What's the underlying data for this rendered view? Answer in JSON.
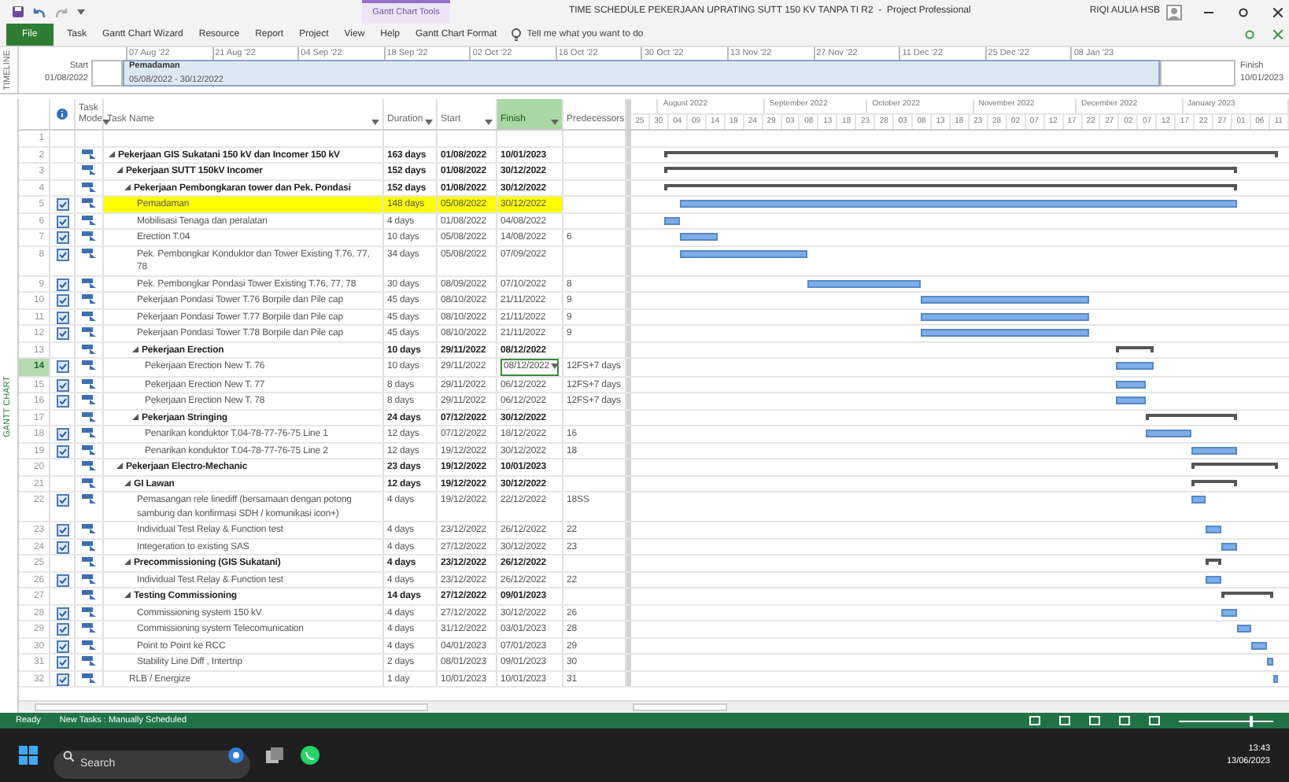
{
  "window": {
    "title": "TIME SCHEDULE PEKERJAAN UPRATING SUTT 150 KV TANPA TI R2  -  Project Professional",
    "context_group": "Gantt Chart Tools",
    "user": "RIQI AULIA HSB"
  },
  "ribbon_tabs": [
    {
      "label": "File",
      "kind": "file"
    },
    {
      "label": "Task",
      "kind": "normal"
    },
    {
      "label": "Gantt Chart Wizard",
      "kind": "normal"
    },
    {
      "label": "Resource",
      "kind": "normal"
    },
    {
      "label": "Report",
      "kind": "normal"
    },
    {
      "label": "Project",
      "kind": "normal"
    },
    {
      "label": "View",
      "kind": "normal"
    },
    {
      "label": "Help",
      "kind": "normal"
    },
    {
      "label": "Gantt Chart Format",
      "kind": "contextual"
    }
  ],
  "tell_me": {
    "placeholder": "Tell me what you want to do"
  },
  "timeline": {
    "label": "TIMELINE",
    "start_label": "Start",
    "start_date": "01/08/2022",
    "finish_label": "Finish",
    "finish_date": "10/01/2023",
    "dates": [
      "07 Aug '22",
      "21 Aug '22",
      "04 Sep '22",
      "18 Sep '22",
      "02 Oct '22",
      "16 Oct '22",
      "30 Oct '22",
      "13 Nov '22",
      "27 Nov '22",
      "11 Dec '22",
      "25 Dec '22",
      "08 Jan '23"
    ],
    "bar": {
      "name": "Pemadaman",
      "range": "05/08/2022 - 30/12/2022"
    }
  },
  "view_label": "GANTT CHART",
  "table": {
    "columns": [
      {
        "label": "Task Mode",
        "filter": true,
        "selected": false
      },
      {
        "label": "Task Name",
        "filter": true,
        "selected": false
      },
      {
        "label": "Duration",
        "filter": true,
        "selected": false
      },
      {
        "label": "Start",
        "filter": true,
        "selected": false
      },
      {
        "label": "Finish",
        "filter": true,
        "selected": true
      },
      {
        "label": "Predecessors",
        "filter": false,
        "selected": false
      }
    ],
    "rows": [
      {
        "row_number": "1",
        "kind": "blank",
        "selected": false,
        "highlighted": false
      },
      {
        "row_number": "2",
        "kind": "summary",
        "name": "Pekerjaan GIS Sukatani 150 kV dan Incomer 150 kV",
        "duration": "163 days",
        "start": "01/08/2022",
        "finish": "10/01/2023",
        "selected": false,
        "highlighted": false,
        "children": [
          {
            "row_number": "3",
            "kind": "summary",
            "name": "Pekerjaan SUTT 150kV Incomer",
            "duration": "152 days",
            "start": "01/08/2022",
            "finish": "30/12/2022",
            "selected": false,
            "highlighted": false,
            "children": [
              {
                "row_number": "4",
                "kind": "summary",
                "name": "Pekerjaan Pembongkaran tower dan Pek. Pondasi",
                "duration": "152 days",
                "start": "01/08/2022",
                "finish": "30/12/2022",
                "selected": false,
                "highlighted": false,
                "children": [
                  {
                    "row_number": "5",
                    "kind": "task",
                    "name": "Pemadaman",
                    "duration": "148 days",
                    "start": "05/08/2022",
                    "finish": "30/12/2022",
                    "selected": false,
                    "highlighted": true
                  },
                  {
                    "row_number": "6",
                    "kind": "task",
                    "name": "Mobilisasi Tenaga dan peralatan",
                    "duration": "4 days",
                    "start": "01/08/2022",
                    "finish": "04/08/2022",
                    "selected": false,
                    "highlighted": false
                  },
                  {
                    "row_number": "7",
                    "kind": "task",
                    "name": "Erection T.04",
                    "duration": "10 days",
                    "start": "05/08/2022",
                    "finish": "14/08/2022",
                    "predecessors": "6",
                    "selected": false,
                    "highlighted": false
                  },
                  {
                    "row_number": "8",
                    "kind": "task",
                    "name": "Pek. Pembongkar Konduktor dan Tower Existing T.76, 77, 78",
                    "duration": "34 days",
                    "start": "05/08/2022",
                    "finish": "07/09/2022",
                    "selected": false,
                    "highlighted": false
                  },
                  {
                    "row_number": "9",
                    "kind": "task",
                    "name": "Pek. Pembongkar Pondasi Tower Existing T.76, 77, 78",
                    "duration": "30 days",
                    "start": "08/09/2022",
                    "finish": "07/10/2022",
                    "predecessors": "8",
                    "selected": false,
                    "highlighted": false
                  },
                  {
                    "row_number": "10",
                    "kind": "task",
                    "name": "Pekerjaan Pondasi Tower T.76 Borpile dan Pile cap",
                    "duration": "45 days",
                    "start": "08/10/2022",
                    "finish": "21/11/2022",
                    "predecessors": "9",
                    "selected": false,
                    "highlighted": false
                  },
                  {
                    "row_number": "11",
                    "kind": "task",
                    "name": "Pekerjaan Pondasi Tower T.77 Borpile dan Pile cap",
                    "duration": "45 days",
                    "start": "08/10/2022",
                    "finish": "21/11/2022",
                    "predecessors": "9",
                    "selected": false,
                    "highlighted": false
                  },
                  {
                    "row_number": "12",
                    "kind": "task",
                    "name": "Pekerjaan Pondasi Tower T.78 Borpile dan Pile cap",
                    "duration": "45 days",
                    "start": "08/10/2022",
                    "finish": "21/11/2022",
                    "predecessors": "9",
                    "selected": false,
                    "highlighted": false
                  },
                  {
                    "row_number": "13",
                    "kind": "summary",
                    "name": "Pekerjaan Erection",
                    "duration": "10 days",
                    "start": "29/11/2022",
                    "finish": "08/12/2022",
                    "selected": false,
                    "highlighted": false,
                    "children": [
                      {
                        "row_number": "14",
                        "kind": "task",
                        "name": "Pekerjaan Erection New T. 76",
                        "duration": "10 days",
                        "start": "29/11/2022",
                        "finish": "08/12/2022",
                        "predecessors": "12FS+7 days",
                        "selected": true,
                        "highlighted": false
                      },
                      {
                        "row_number": "15",
                        "kind": "task",
                        "name": "Pekerjaan Erection New T. 77",
                        "duration": "8 days",
                        "start": "29/11/2022",
                        "finish": "06/12/2022",
                        "predecessors": "12FS+7 days",
                        "selected": false,
                        "highlighted": false
                      },
                      {
                        "row_number": "16",
                        "kind": "task",
                        "name": "Pekerjaan Erection New T. 78",
                        "duration": "8 days",
                        "start": "29/11/2022",
                        "finish": "06/12/2022",
                        "predecessors": "12FS+7 days",
                        "selected": false,
                        "highlighted": false
                      }
                    ]
                  },
                  {
                    "row_number": "17",
                    "kind": "summary",
                    "name": "Pekerjaan Stringing",
                    "duration": "24 days",
                    "start": "07/12/2022",
                    "finish": "30/12/2022",
                    "selected": false,
                    "highlighted": false,
                    "children": [
                      {
                        "row_number": "18",
                        "kind": "task",
                        "name": "Penarikan konduktor T.04-78-77-76-75 Line 1",
                        "duration": "12 days",
                        "start": "07/12/2022",
                        "finish": "18/12/2022",
                        "predecessors": "16",
                        "selected": false,
                        "highlighted": false
                      },
                      {
                        "row_number": "19",
                        "kind": "task",
                        "name": "Penarikan konduktor T.04-78-77-76-75 Line 2",
                        "duration": "12 days",
                        "start": "19/12/2022",
                        "finish": "30/12/2022",
                        "predecessors": "18",
                        "selected": false,
                        "highlighted": false
                      }
                    ]
                  }
                ]
              }
            ]
          },
          {
            "row_number": "20",
            "kind": "summary",
            "name": "Pekerjaan Electro-Mechanic",
            "duration": "23 days",
            "start": "19/12/2022",
            "finish": "10/01/2023",
            "selected": false,
            "highlighted": false,
            "children": [
              {
                "row_number": "21",
                "kind": "summary",
                "name": "GI Lawan",
                "duration": "12 days",
                "start": "19/12/2022",
                "finish": "30/12/2022",
                "selected": false,
                "highlighted": false,
                "children": [
                  {
                    "row_number": "22",
                    "kind": "task",
                    "name": "Pemasangan rele linediff (bersamaan dengan potong sambung dan konfirmasi SDH / komunikasi icon+)",
                    "duration": "4 days",
                    "start": "19/12/2022",
                    "finish": "22/12/2022",
                    "predecessors": "18SS",
                    "selected": false,
                    "highlighted": false
                  },
                  {
                    "row_number": "23",
                    "kind": "task",
                    "name": "Individual Test Relay & Function test",
                    "duration": "4 days",
                    "start": "23/12/2022",
                    "finish": "26/12/2022",
                    "predecessors": "22",
                    "selected": false,
                    "highlighted": false
                  },
                  {
                    "row_number": "24",
                    "kind": "task",
                    "name": "Integeration to existing SAS",
                    "duration": "4 days",
                    "start": "27/12/2022",
                    "finish": "30/12/2022",
                    "predecessors": "23",
                    "selected": false,
                    "highlighted": false
                  }
                ]
              },
              {
                "row_number": "25",
                "kind": "summary",
                "name": "Precommissioning (GIS Sukatani)",
                "duration": "4 days",
                "start": "23/12/2022",
                "finish": "26/12/2022",
                "selected": false,
                "highlighted": false,
                "children": [
                  {
                    "row_number": "26",
                    "kind": "task",
                    "name": "Individual Test Relay & Function test",
                    "duration": "4 days",
                    "start": "23/12/2022",
                    "finish": "26/12/2022",
                    "predecessors": "22",
                    "selected": false,
                    "highlighted": false
                  }
                ]
              },
              {
                "row_number": "27",
                "kind": "summary",
                "name": "Testing Commissioning",
                "duration": "14 days",
                "start": "27/12/2022",
                "finish": "09/01/2023",
                "selected": false,
                "highlighted": false,
                "children": [
                  {
                    "row_number": "28",
                    "kind": "task",
                    "name": "Commissioning system 150 kV",
                    "duration": "4 days",
                    "start": "27/12/2022",
                    "finish": "30/12/2022",
                    "predecessors": "26",
                    "selected": false,
                    "highlighted": false
                  },
                  {
                    "row_number": "29",
                    "kind": "task",
                    "name": "Commissioning system Telecomunication",
                    "duration": "4 days",
                    "start": "31/12/2022",
                    "finish": "03/01/2023",
                    "predecessors": "28",
                    "selected": false,
                    "highlighted": false
                  },
                  {
                    "row_number": "30",
                    "kind": "task",
                    "name": "Point to Point ke RCC",
                    "duration": "4 days",
                    "start": "04/01/2023",
                    "finish": "07/01/2023",
                    "predecessors": "29",
                    "selected": false,
                    "highlighted": false
                  },
                  {
                    "row_number": "31",
                    "kind": "task",
                    "name": "Stability Line Diff , Intertrip",
                    "duration": "2 days",
                    "start": "08/01/2023",
                    "finish": "09/01/2023",
                    "predecessors": "30",
                    "selected": false,
                    "highlighted": false
                  }
                ]
              },
              {
                "row_number": "32",
                "kind": "task",
                "name": "RLB / Energize",
                "duration": "1 day",
                "start": "10/01/2023",
                "finish": "10/01/2023",
                "predecessors": "31",
                "selected": false,
                "highlighted": false
              }
            ]
          }
        ]
      }
    ]
  },
  "gantt_header": {
    "months": [
      "August 2022",
      "September 2022",
      "October 2022",
      "November 2022",
      "December 2022",
      "January 2023"
    ],
    "days": [
      "25",
      "30",
      "04",
      "09",
      "14",
      "19",
      "24",
      "29",
      "03",
      "08",
      "13",
      "18",
      "23",
      "28",
      "03",
      "08",
      "13",
      "18",
      "23",
      "28",
      "02",
      "07",
      "12",
      "17",
      "22",
      "27",
      "02",
      "07",
      "12",
      "17",
      "22",
      "27",
      "01",
      "06",
      "11"
    ]
  },
  "status_bar": {
    "ready": "Ready",
    "task_mode": "New Tasks : Manually Scheduled",
    "zoom": {
      "level": 0.75
    }
  },
  "taskbar": {
    "search": {
      "placeholder": "Search"
    },
    "time": "13:43",
    "date": "13/06/2023"
  }
}
